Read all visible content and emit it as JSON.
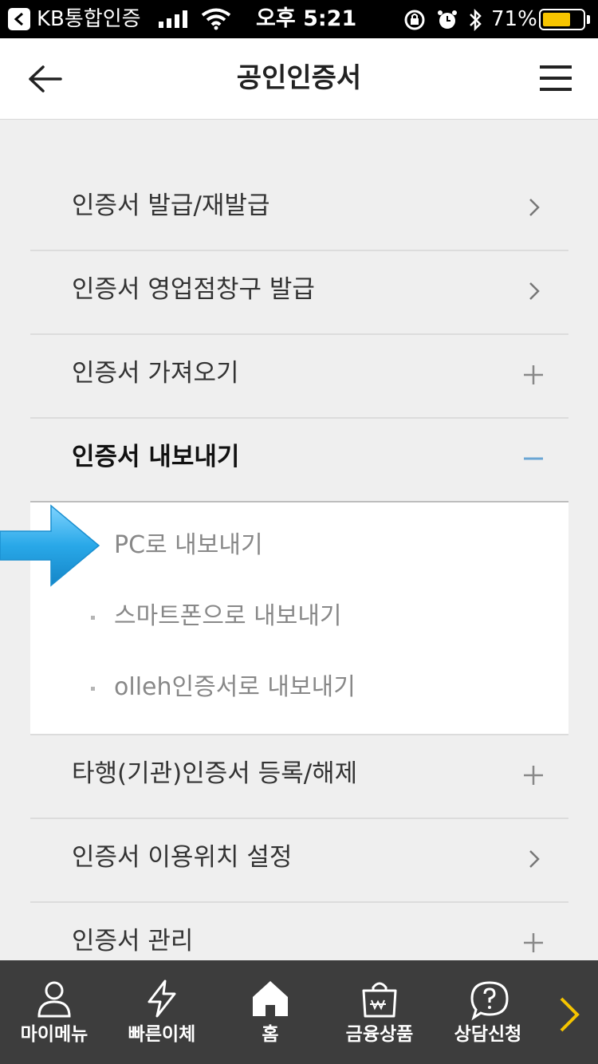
{
  "status_bar": {
    "app_name": "KB통합인증",
    "time": "오후 5:21",
    "battery_text": "71%",
    "battery_level": 0.71
  },
  "header": {
    "title": "공인인증서"
  },
  "menu": {
    "items": [
      {
        "label": "인증서 발급/재발급",
        "icon": "chevron-right-icon"
      },
      {
        "label": "인증서 영업점창구 발급",
        "icon": "chevron-right-icon"
      },
      {
        "label": "인증서 가져오기",
        "icon": "plus-icon"
      },
      {
        "label": "인증서 내보내기",
        "icon": "minus-icon"
      },
      {
        "label": "타행(기관)인증서 등록/해제",
        "icon": "plus-icon"
      },
      {
        "label": "인증서 이용위치 설정",
        "icon": "chevron-right-icon"
      },
      {
        "label": "인증서 관리",
        "icon": "plus-icon"
      }
    ],
    "expanded_sub_items": [
      {
        "label": "PC로 내보내기"
      },
      {
        "label": "스마트폰으로 내보내기"
      },
      {
        "label": "olleh인증서로 내보내기"
      }
    ]
  },
  "bottom_nav": {
    "items": [
      {
        "label": "마이메뉴",
        "icon": "person-icon"
      },
      {
        "label": "빠른이체",
        "icon": "lightning-icon"
      },
      {
        "label": "홈",
        "icon": "home-icon"
      },
      {
        "label": "금융상품",
        "icon": "shopping-bag-icon"
      },
      {
        "label": "상담신청",
        "icon": "question-bubble-icon"
      }
    ]
  },
  "colors": {
    "accent_arrow": "#29a8e8",
    "minus_icon": "#6aa6d4",
    "nav_bg": "#3d3d3d",
    "nav_more": "#f5c400"
  }
}
